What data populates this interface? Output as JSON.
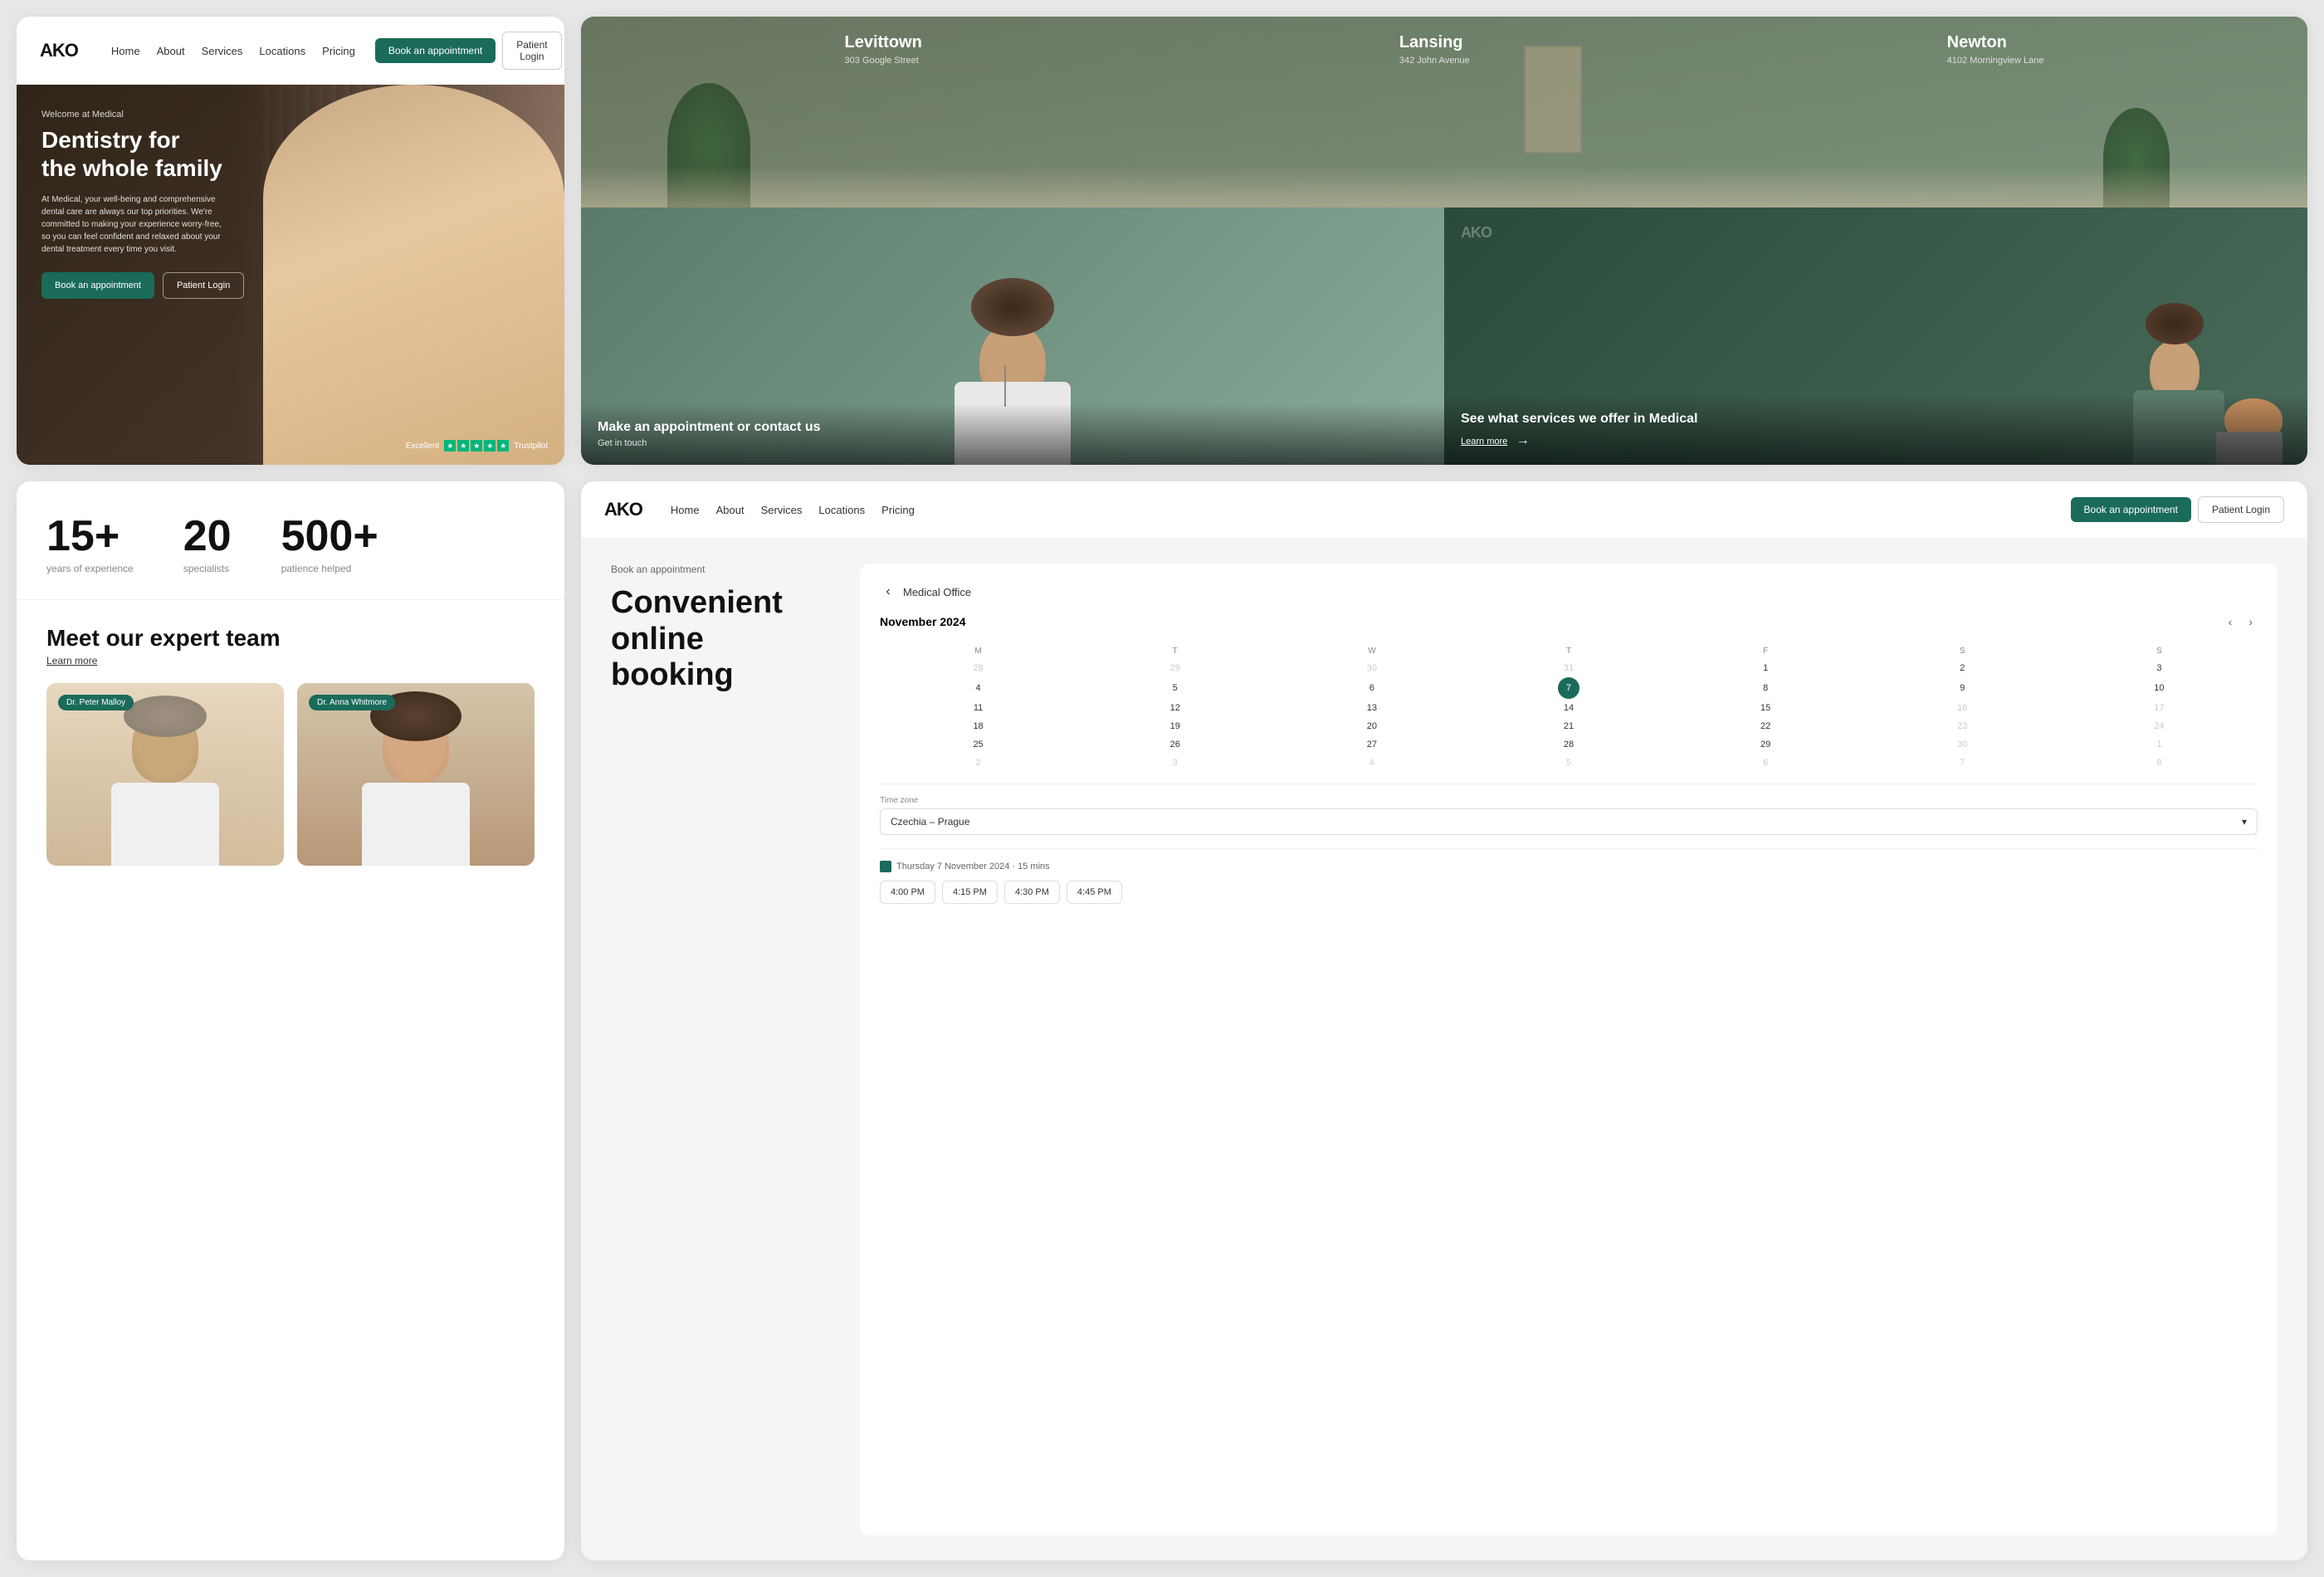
{
  "hero": {
    "logo": "AKO",
    "nav": {
      "links": [
        "Home",
        "About",
        "Services",
        "Locations",
        "Pricing"
      ],
      "book_label": "Book an appointment",
      "login_label": "Patient Login"
    },
    "welcome": "Welcome at Medical",
    "title_line1": "Dentistry for",
    "title_line2": "the whole family",
    "description": "At Medical, your well-being and comprehensive dental care are always our top priorities. We're committed to making your experience worry-free, so you can feel confident and relaxed about your dental treatment every time you visit.",
    "cta_book": "Book an appointment",
    "cta_login": "Patient Login",
    "trustpilot_label": "Excellent",
    "trustpilot_brand": "Trustpilot"
  },
  "locations": {
    "cities": [
      {
        "name": "Levittown",
        "address": "303 Google Street"
      },
      {
        "name": "Lansing",
        "address": "342 John Avenue"
      },
      {
        "name": "Newton",
        "address": "4102 Morningview Lane"
      }
    ],
    "cards": [
      {
        "title": "Make an appointment or contact us",
        "subtitle": "Get in touch"
      },
      {
        "title": "See what services we offer in Medical",
        "learn_more": "Learn more"
      }
    ]
  },
  "stats": {
    "items": [
      {
        "number": "15+",
        "label": "years of experience"
      },
      {
        "number": "20",
        "label": "specialists"
      },
      {
        "number": "500+",
        "label": "patience helped"
      }
    ]
  },
  "team": {
    "title": "Meet our expert team",
    "learn_more": "Learn more",
    "doctors": [
      {
        "name": "Dr. Peter Malloy"
      },
      {
        "name": "Dr. Anna Whitmore"
      }
    ]
  },
  "booking": {
    "logo": "AKO",
    "nav": {
      "links": [
        "Home",
        "About",
        "Services",
        "Locations",
        "Pricing"
      ],
      "book_label": "Book an appointment",
      "login_label": "Patient Login"
    },
    "section_label": "Book an appointment",
    "title_line1": "Convenient online",
    "title_line2": "booking",
    "office_name": "Medical Office",
    "calendar": {
      "month": "November",
      "year": "2024",
      "day_headers": [
        "M",
        "T",
        "W",
        "T",
        "F",
        "S",
        "S"
      ],
      "weeks": [
        [
          {
            "day": "28",
            "other": true
          },
          {
            "day": "29",
            "other": true
          },
          {
            "day": "30",
            "other": true
          },
          {
            "day": "31",
            "other": true
          },
          {
            "day": "1"
          },
          {
            "day": "2"
          },
          {
            "day": "3"
          }
        ],
        [
          {
            "day": "4"
          },
          {
            "day": "5"
          },
          {
            "day": "6"
          },
          {
            "day": "7",
            "today": true
          },
          {
            "day": "8"
          },
          {
            "day": "9"
          },
          {
            "day": "10"
          }
        ],
        [
          {
            "day": "11"
          },
          {
            "day": "12"
          },
          {
            "day": "13"
          },
          {
            "day": "14"
          },
          {
            "day": "15"
          },
          {
            "day": "16",
            "disabled": true
          },
          {
            "day": "17",
            "disabled": true
          }
        ],
        [
          {
            "day": "18"
          },
          {
            "day": "19"
          },
          {
            "day": "20"
          },
          {
            "day": "21"
          },
          {
            "day": "22"
          },
          {
            "day": "23",
            "disabled": true
          },
          {
            "day": "24",
            "disabled": true
          }
        ],
        [
          {
            "day": "25"
          },
          {
            "day": "26"
          },
          {
            "day": "27"
          },
          {
            "day": "28"
          },
          {
            "day": "29"
          },
          {
            "day": "30",
            "disabled": true
          },
          {
            "day": "1",
            "other": true
          }
        ],
        [
          {
            "day": "2",
            "other": true
          },
          {
            "day": "3",
            "other": true
          },
          {
            "day": "4",
            "other": true
          },
          {
            "day": "5",
            "other": true
          },
          {
            "day": "6",
            "other": true
          },
          {
            "day": "7",
            "other": true
          },
          {
            "day": "8",
            "other": true
          }
        ]
      ]
    },
    "timezone_label": "Time zone",
    "timezone_value": "Czechia – Prague",
    "timeslot_date": "Thursday 7 November 2024 · 15 mins",
    "timeslots": [
      "4:00 PM",
      "4:15 PM",
      "4:30 PM",
      "4:45 PM"
    ]
  }
}
